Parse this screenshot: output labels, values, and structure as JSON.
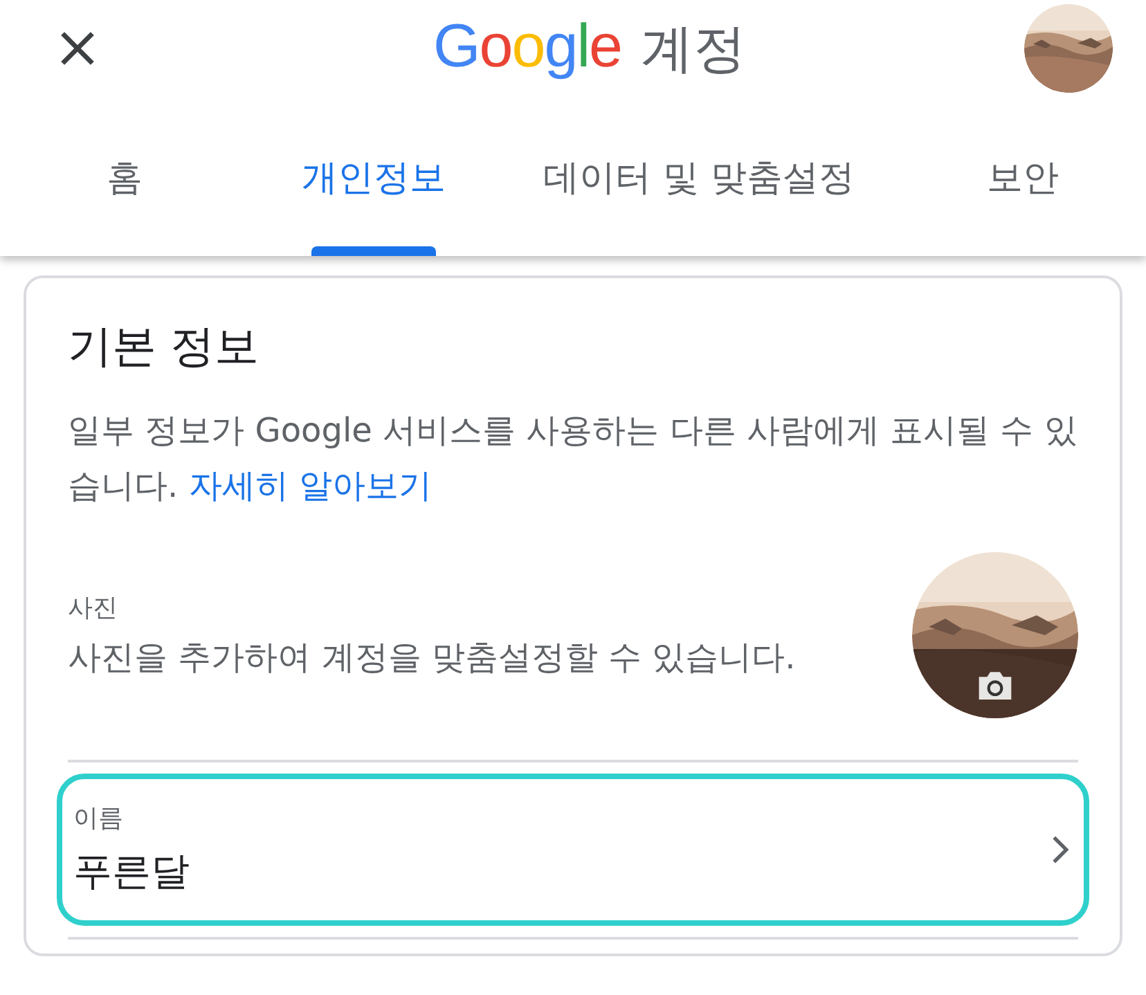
{
  "header": {
    "logo": "Google",
    "title": "계정"
  },
  "tabs": [
    {
      "label": "홈",
      "selected": false
    },
    {
      "label": "개인정보",
      "selected": true
    },
    {
      "label": "데이터 및 맞춤설정",
      "selected": false
    },
    {
      "label": "보안",
      "selected": false
    }
  ],
  "section": {
    "title": "기본 정보",
    "description": "일부 정보가 Google 서비스를 사용하는 다른 사람에게 표시될 수 있습니다.",
    "link": "자세히 알아보기"
  },
  "photo": {
    "label": "사진",
    "text": "사진을 추가하여 계정을 맞춤설정할 수 있습니다."
  },
  "name": {
    "label": "이름",
    "value": "푸른달",
    "highlighted": true
  }
}
